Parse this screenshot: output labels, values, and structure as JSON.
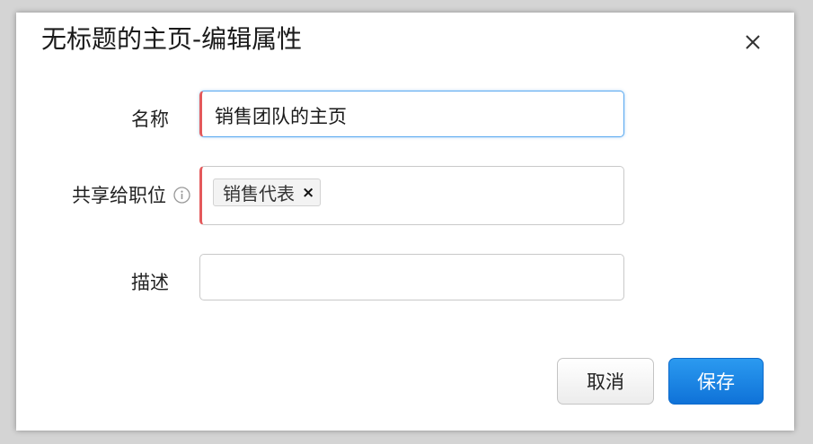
{
  "dialog": {
    "title": "无标题的主页-编辑属性",
    "close_icon": "close-icon"
  },
  "form": {
    "name": {
      "label": "名称",
      "value": "销售团队的主页"
    },
    "share": {
      "label": "共享给职位",
      "info_icon": "info-icon",
      "tags": [
        "销售代表"
      ],
      "tag_remove": "×"
    },
    "description": {
      "label": "描述",
      "value": ""
    }
  },
  "buttons": {
    "cancel": "取消",
    "save": "保存"
  },
  "colors": {
    "required_marker": "#e4595b",
    "focus_border": "#5aa9f0",
    "primary": "#1580e0"
  }
}
